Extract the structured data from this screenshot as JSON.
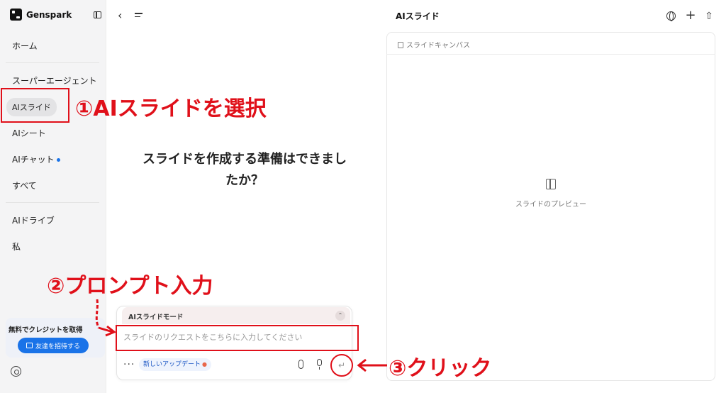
{
  "sidebar": {
    "brand": "Genspark",
    "items": [
      {
        "label": "ホーム"
      },
      {
        "label": "スーパーエージェント"
      },
      {
        "label": "AIスライド"
      },
      {
        "label": "AIシート"
      },
      {
        "label": "AIチャット"
      },
      {
        "label": "すべて"
      },
      {
        "label": "AIドライブ"
      },
      {
        "label": "私"
      }
    ],
    "credit_title": "無料でクレジットを取得",
    "invite_label": "友達を招待する"
  },
  "header": {
    "title": "AIスライド"
  },
  "main": {
    "headline": "スライドを作成する準備はできましたか？",
    "composer": {
      "mode_label": "AIスライドモード",
      "placeholder": "スライドのリクエストをこちらに入力してください",
      "update_chip": "新しいアップデート"
    }
  },
  "canvas": {
    "title": "スライドキャンバス",
    "preview_label": "スライドのプレビュー"
  },
  "annotations": {
    "step1": "①AIスライドを選択",
    "step2": "②プロンプト入力",
    "step3": "③クリック",
    "color": "#e0101a"
  },
  "colors": {
    "accent": "#1a73e8",
    "sidebar_bg": "#f4f4f5",
    "mode_bar_bg": "#f6eeee"
  }
}
